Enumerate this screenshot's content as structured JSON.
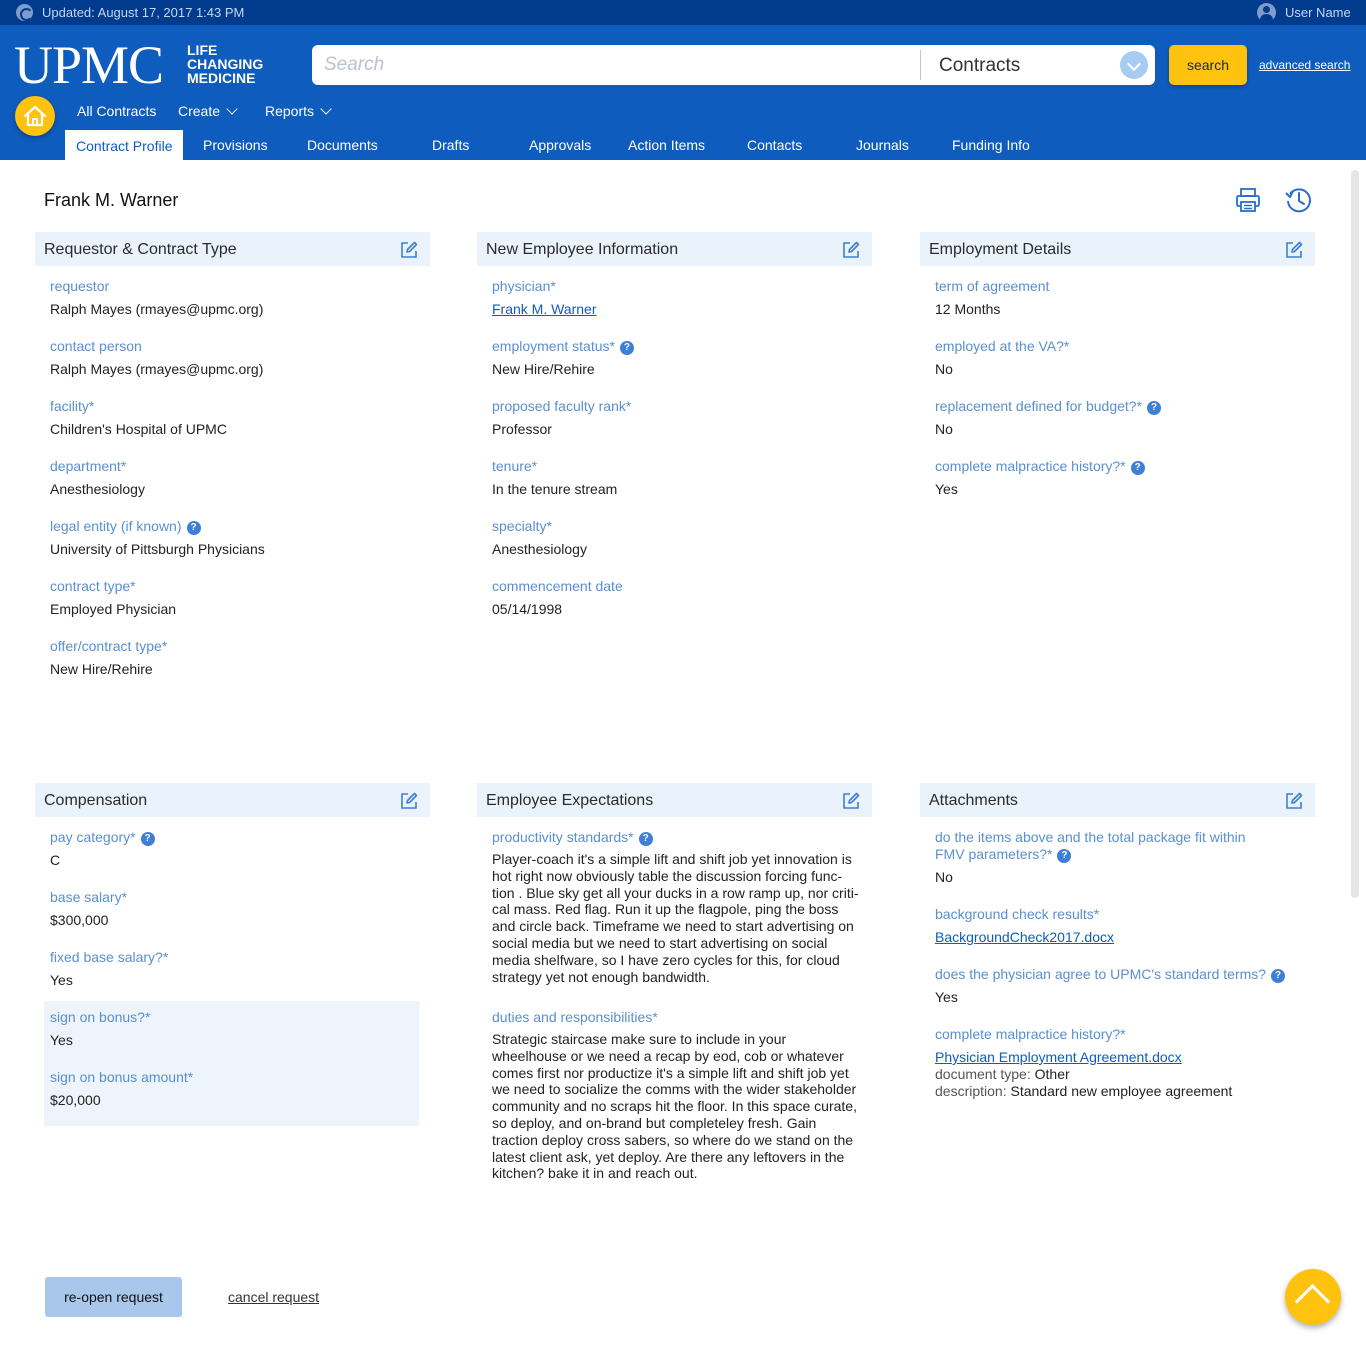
{
  "topbar": {
    "updated": "Updated: August 17, 2017 1:43 PM",
    "user_name": "User Name"
  },
  "header": {
    "logo_text": "UPMC",
    "logo_tag": [
      "LIFE",
      "CHANGING",
      "MEDICINE"
    ],
    "search_placeholder": "Search",
    "search_scope": "Contracts",
    "search_button": "search",
    "advanced_search": "advanced search"
  },
  "nav": {
    "all_contracts": "All Contracts",
    "create": "Create",
    "reports": "Reports"
  },
  "tabs": [
    "Contract Profile",
    "Provisions",
    "Documents",
    "Drafts",
    "Approvals",
    "Action Items",
    "Contacts",
    "Journals",
    "Funding Info"
  ],
  "page_title": "Frank M. Warner",
  "panels": {
    "requestor": {
      "title": "Requestor & Contract Type",
      "fields": [
        {
          "label": "requestor",
          "value": "Ralph Mayes (rmayes@upmc.org)"
        },
        {
          "label": "contact person",
          "value": "Ralph Mayes (rmayes@upmc.org)"
        },
        {
          "label": "facility*",
          "value": "Children's Hospital of UPMC"
        },
        {
          "label": "department*",
          "value": "Anesthesiology"
        },
        {
          "label": "legal entity (if known)",
          "value": "University of Pittsburgh Physicians"
        },
        {
          "label": "contract type*",
          "value": "Employed Physician"
        },
        {
          "label": "offer/contract type*",
          "value": "New Hire/Rehire"
        }
      ]
    },
    "new_employee": {
      "title": "New Employee Information",
      "fields": [
        {
          "label": "physician*",
          "value": "Frank M. Warner"
        },
        {
          "label": "employment status*",
          "value": "New Hire/Rehire"
        },
        {
          "label": "proposed faculty rank*",
          "value": "Professor"
        },
        {
          "label": "tenure*",
          "value": "In the tenure stream"
        },
        {
          "label": "specialty*",
          "value": "Anesthesiology"
        },
        {
          "label": "commencement date",
          "value": "05/14/1998"
        }
      ]
    },
    "employment": {
      "title": "Employment Details",
      "fields": [
        {
          "label": "term of agreement",
          "value": "12 Months"
        },
        {
          "label": "employed at the VA?*",
          "value": "No"
        },
        {
          "label": "replacement defined for budget?*",
          "value": "No"
        },
        {
          "label": "complete malpractice history?*",
          "value": "Yes"
        }
      ]
    },
    "compensation": {
      "title": "Compensation",
      "fields": [
        {
          "label": "pay category*",
          "value": "C"
        },
        {
          "label": "base salary*",
          "value": "$300,000"
        },
        {
          "label": "fixed base salary?*",
          "value": "Yes"
        },
        {
          "label": "sign on bonus?*",
          "value": "Yes"
        },
        {
          "label": "sign on bonus amount*",
          "value": "$20,000"
        }
      ]
    },
    "expectations": {
      "title": "Employee Expectations",
      "fields": [
        {
          "label": "productivity standards*",
          "value": "Player-coach it's a simple lift and shift job yet innovation is hot right now obviously table the discussion forcing func- tion . Blue sky get all your ducks in a row ramp up, nor criti- cal mass. Red flag. Run it up the flagpole, ping the boss and circle back. Timeframe we need to start advertising on social media but we need to start advertising on social media shelfware, so I have zero cycles for this, for cloud strategy yet not enough bandwidth."
        },
        {
          "label": "duties and responsibilities*",
          "value": "Strategic staircase make sure to include in your wheelhouse or we need a recap by eod, cob or whatever comes first nor productize it's a simple lift and shift job yet we need to socialize the comms with the wider stakeholder community and no scraps hit the floor. In this space curate, so deploy, and on-brand but completeley fresh. Gain traction deploy cross sabers, so where do we stand on the latest client ask, yet deploy. Are there any leftovers in the kitchen? bake it in and reach out."
        }
      ]
    },
    "attachments": {
      "title": "Attachments",
      "fields": [
        {
          "label": "do the items above and the total package fit within FMV parameters?*",
          "value": "No"
        },
        {
          "label": "background check results*",
          "value": "BackgroundCheck2017.docx"
        },
        {
          "label": "does the physician agree to UPMC's standard terms?",
          "value": "Yes"
        },
        {
          "label": "complete malpractice history?*",
          "value": "Physician Employment Agreement.docx"
        }
      ],
      "doc_type_label": "document type:",
      "doc_type_value": "Other",
      "description_label": "description:",
      "description_value": "Standard new employee agreement"
    }
  },
  "footer": {
    "reopen": "re-open request",
    "cancel": "cancel request"
  },
  "colors": {
    "header_blue": "#0e5cbd",
    "topbar_blue": "#003b8e",
    "accent_yellow": "#ffc20e",
    "label_blue": "#5a8fd0"
  }
}
